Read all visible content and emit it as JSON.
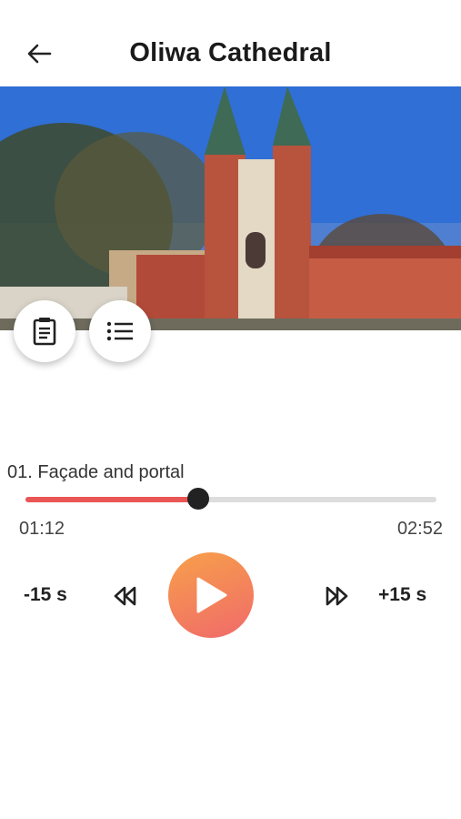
{
  "header": {
    "title": "Oliwa Cathedral",
    "back_icon": "arrow-left-icon"
  },
  "hero": {
    "image": "cathedral-photo"
  },
  "fabs": [
    {
      "icon": "notepad-icon"
    },
    {
      "icon": "list-icon"
    }
  ],
  "player": {
    "track_title": "01. Façade and portal",
    "current_time": "01:12",
    "total_time": "02:52",
    "progress": 0.42,
    "skip_back_label": "-15 s",
    "skip_forward_label": "+15 s",
    "play_icon": "play-icon",
    "rewind_icon": "rewind-icon",
    "fast_forward_icon": "fast-forward-icon",
    "accent_color": "#ea5656",
    "play_gradient": [
      "#f7a04a",
      "#f06a6a"
    ]
  }
}
